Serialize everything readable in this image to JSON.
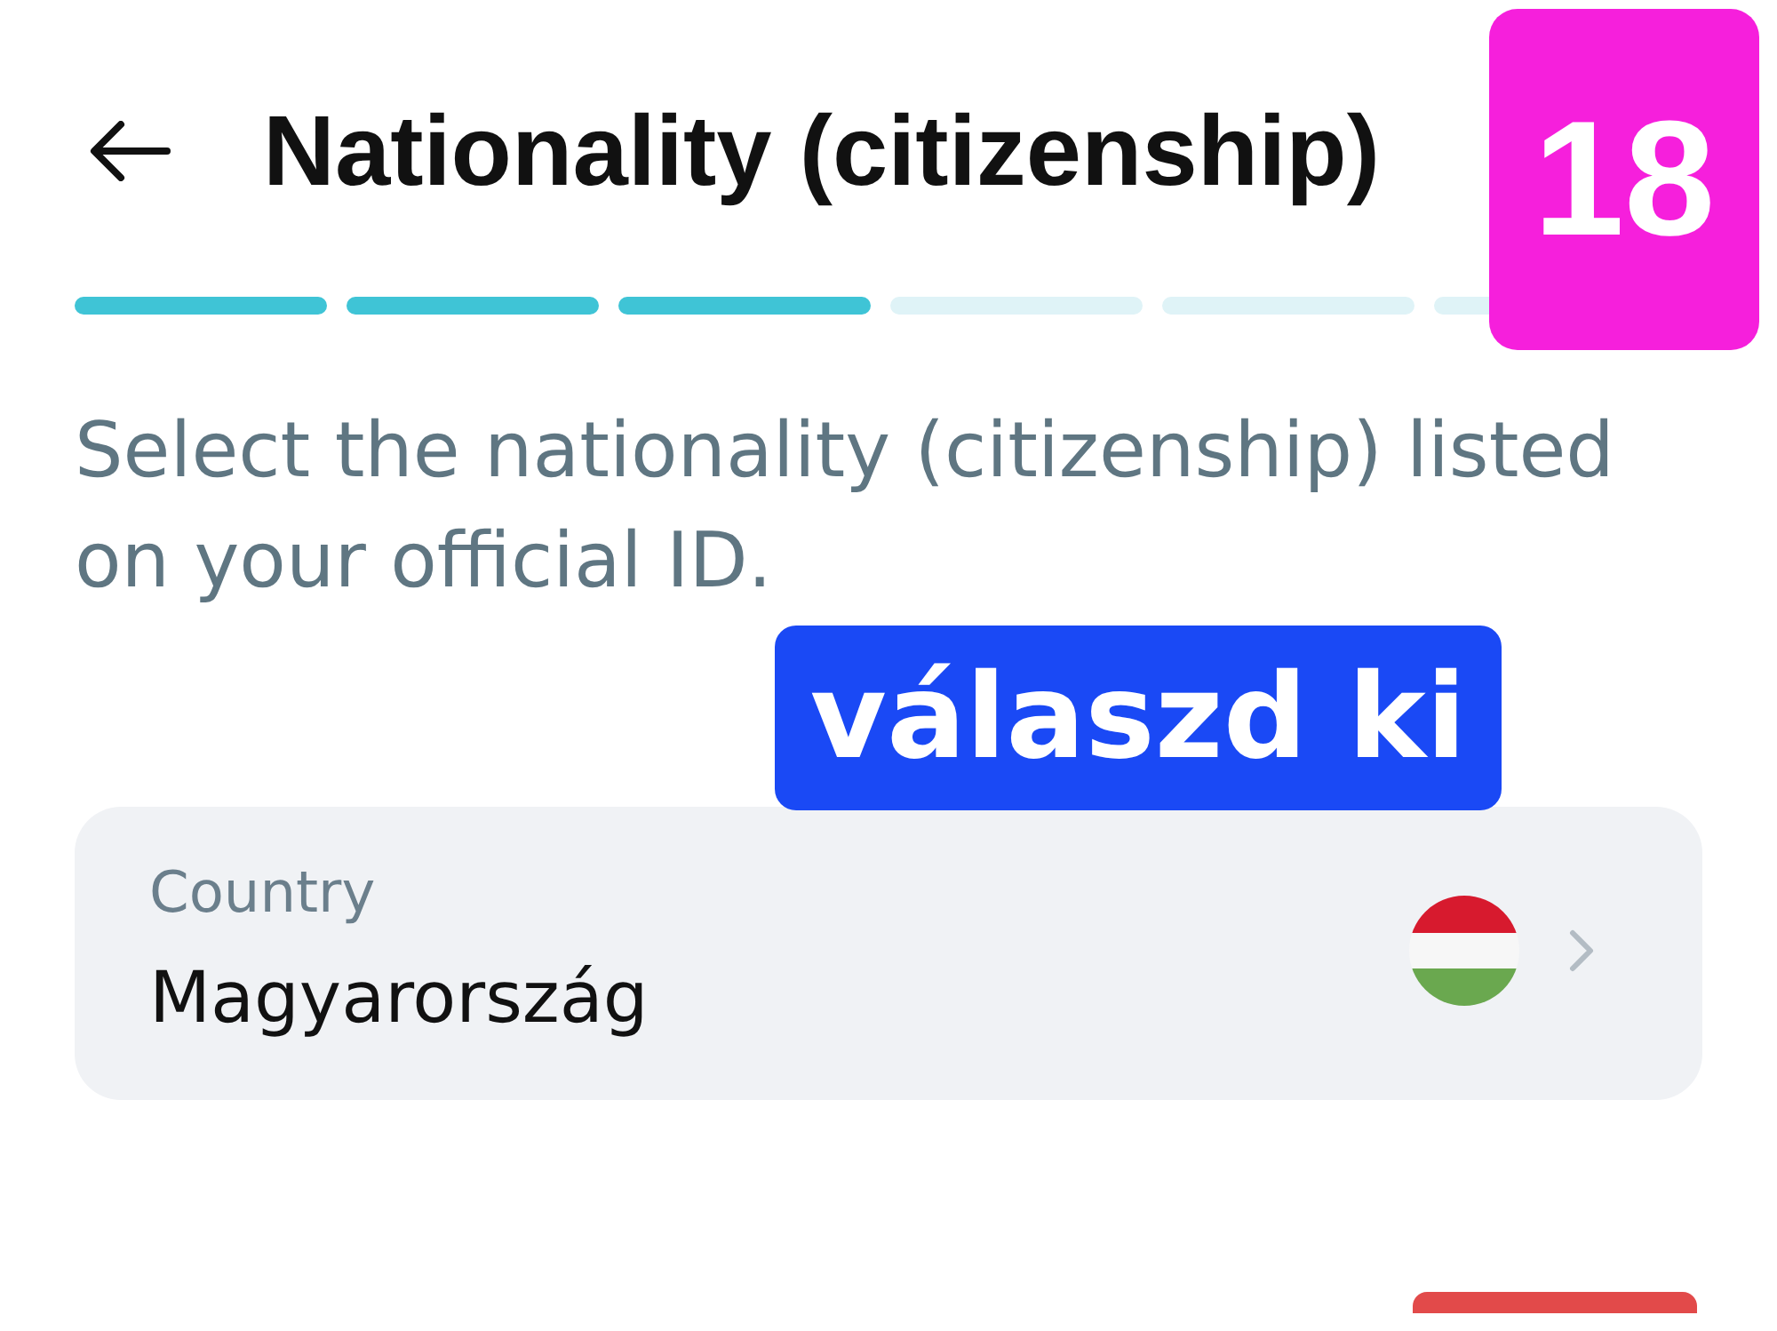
{
  "header": {
    "title": "Nationality (citizenship)"
  },
  "progress": {
    "segments": [
      {
        "filled": true
      },
      {
        "filled": true
      },
      {
        "filled": true
      },
      {
        "filled": false
      },
      {
        "filled": false
      },
      {
        "filled": false
      }
    ]
  },
  "description": "Select the nationality (citizenship) listed on your official ID.",
  "country_field": {
    "label": "Country",
    "value": "Magyarország"
  },
  "annotations": [
    {
      "kind": "badge",
      "text": "18"
    },
    {
      "kind": "callout",
      "text": "válaszd ki"
    }
  ]
}
